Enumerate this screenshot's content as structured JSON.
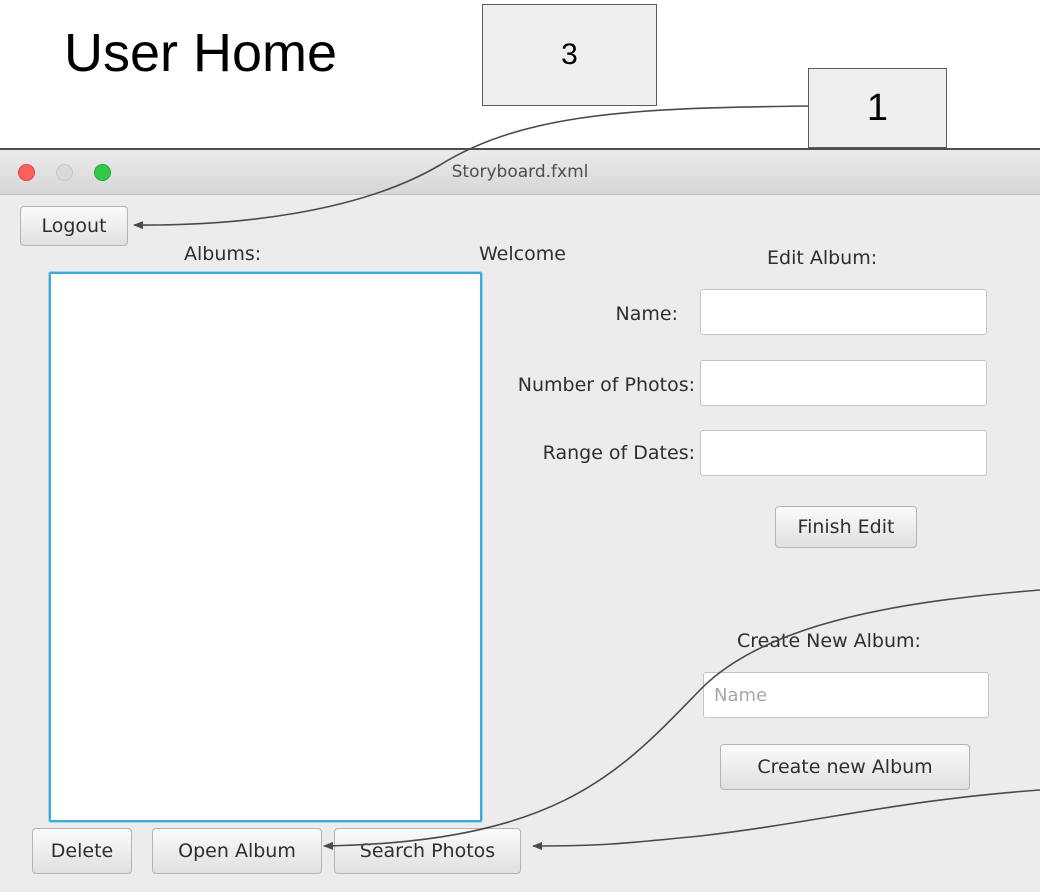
{
  "page": {
    "title": "User Home",
    "callouts": [
      "3",
      "1"
    ]
  },
  "window": {
    "title": "Storyboard.fxml",
    "logout_label": "Logout",
    "albums_label": "Albums:",
    "welcome_label": "Welcome",
    "edit_album": {
      "heading": "Edit Album:",
      "name_label": "Name:",
      "name_value": "",
      "photos_label": "Number of Photos:",
      "photos_value": "",
      "dates_label": "Range of Dates:",
      "dates_value": "",
      "finish_label": "Finish Edit"
    },
    "create_album": {
      "heading": "Create New Album:",
      "name_placeholder": "Name",
      "name_value": "",
      "create_label": "Create new Album"
    },
    "bottom_buttons": {
      "delete_label": "Delete",
      "open_label": "Open Album",
      "search_label": "Search Photos"
    }
  },
  "colors": {
    "window_background": "#ececec",
    "list_focus_border": "#3fa9dd",
    "traffic_close": "#fc605c",
    "traffic_minimize": "#d9d9d9",
    "traffic_maximize": "#34c84a",
    "annotation_line": "#4a4a4a"
  }
}
